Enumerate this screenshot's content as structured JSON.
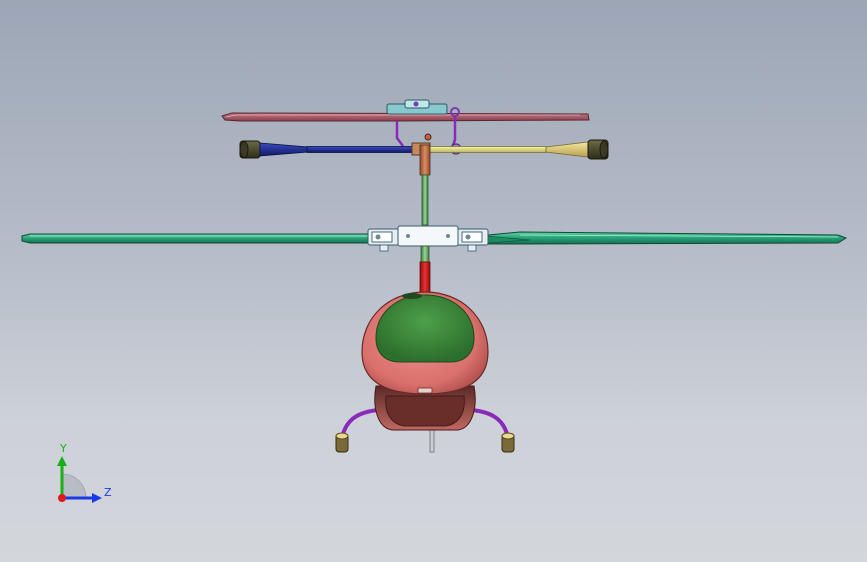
{
  "viewport": {
    "background_top": "#9da6b6",
    "background_bottom": "#d3d6db"
  },
  "model": {
    "parts": {
      "upper_blade_color": "#b05a6a",
      "main_blade_color": "#2aa87a",
      "flybar_dark_color": "#1e2a8a",
      "flybar_light_color": "#e8e58a",
      "weight_color": "#4a4a30",
      "mast_color": "#c06040",
      "mast_red_color": "#d81c1c",
      "canopy_color": "#e07a78",
      "canopy_window_color": "#3c8a3c",
      "skid_color": "#8a2ab8",
      "hub_color": "#dfe8f0"
    }
  },
  "triad": {
    "y_label": "Y",
    "z_label": "Z",
    "y_color": "#18b018",
    "z_color": "#1a3aea",
    "origin_color": "#e01818"
  }
}
